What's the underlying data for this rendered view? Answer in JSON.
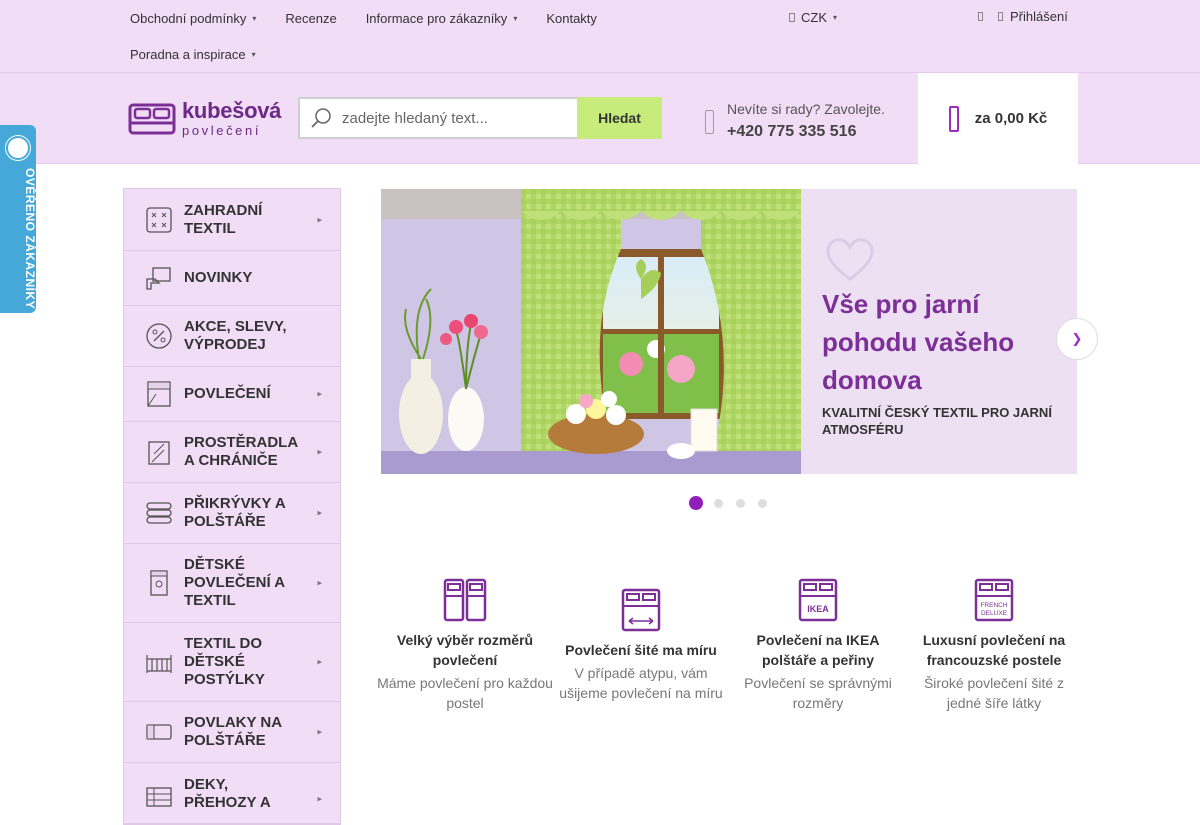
{
  "topbar": {
    "nav": [
      "Obchodní podmínky",
      "Recenze",
      "Informace pro zákazníky",
      "Kontakty"
    ],
    "nav_second_row": [
      "Poradna a inspirace"
    ],
    "currency": "CZK",
    "login": "Přihlášení"
  },
  "header": {
    "logo_name": "kubešová",
    "logo_sub": "povlečení",
    "search_placeholder": "zadejte hledaný text...",
    "search_button": "Hledat",
    "phone_hint": "Nevíte si rady? Zavolejte.",
    "phone_number": "+420 775 335 516",
    "cart_total": "za 0,00 Kč"
  },
  "sidebar": {
    "categories": [
      {
        "label": "Zahradní textil",
        "icon": "garden-textile-icon",
        "has_sub": true
      },
      {
        "label": "Novinky",
        "icon": "new-items-icon",
        "has_sub": false
      },
      {
        "label": "Akce, slevy, výprodej",
        "icon": "percent-icon",
        "has_sub": false
      },
      {
        "label": "Povlečení",
        "icon": "bedding-icon",
        "has_sub": true
      },
      {
        "label": "Prostěradla a chrániče",
        "icon": "sheet-icon",
        "has_sub": true
      },
      {
        "label": "Přikrývky a polštáře",
        "icon": "duvet-icon",
        "has_sub": true
      },
      {
        "label": "Dětské povlečení a textil",
        "icon": "kids-bedding-icon",
        "has_sub": true
      },
      {
        "label": "Textil do dětské postýlky",
        "icon": "crib-icon",
        "has_sub": true
      },
      {
        "label": "Povlaky na polštáře",
        "icon": "pillowcase-icon",
        "has_sub": true
      },
      {
        "label": "Deky, přehozy a",
        "icon": "blanket-icon",
        "has_sub": true
      }
    ]
  },
  "slider": {
    "title": "Vše pro jarní pohodu vašeho domova",
    "subtitle": "KVALITNÍ ČESKÝ TEXTIL PRO JARNÍ ATMOSFÉRU",
    "slide_count": 4,
    "active_slide": 1
  },
  "features": [
    {
      "title": "Velký výběr rozměrů povlečení",
      "desc": "Máme povlečení pro každou postel",
      "icon": "bed-sizes-icon"
    },
    {
      "title": "Povlečení šité ma míru",
      "desc": "V případě atypu, vám ušijeme povlečení na míru",
      "icon": "custom-size-icon"
    },
    {
      "title": "Povlečení na IKEA polštáře a peřiny",
      "desc": "Povlečení se správnými rozměry",
      "icon": "ikea-icon",
      "icon_text": "IKEA"
    },
    {
      "title": "Luxusní povlečení na francouzské postele",
      "desc": "Široké povlečení šité z jedné šíře látky",
      "icon": "french-deluxe-icon",
      "icon_text": "FRENCH DELUXE"
    }
  ],
  "verified_badge": "OVĚŘENO ZÁKAZNÍKY",
  "colors": {
    "topbar_bg": "#f2ddf6",
    "accent": "#8f1fb8",
    "search_button": "#c8ec7c",
    "badge": "#45a8d9"
  }
}
